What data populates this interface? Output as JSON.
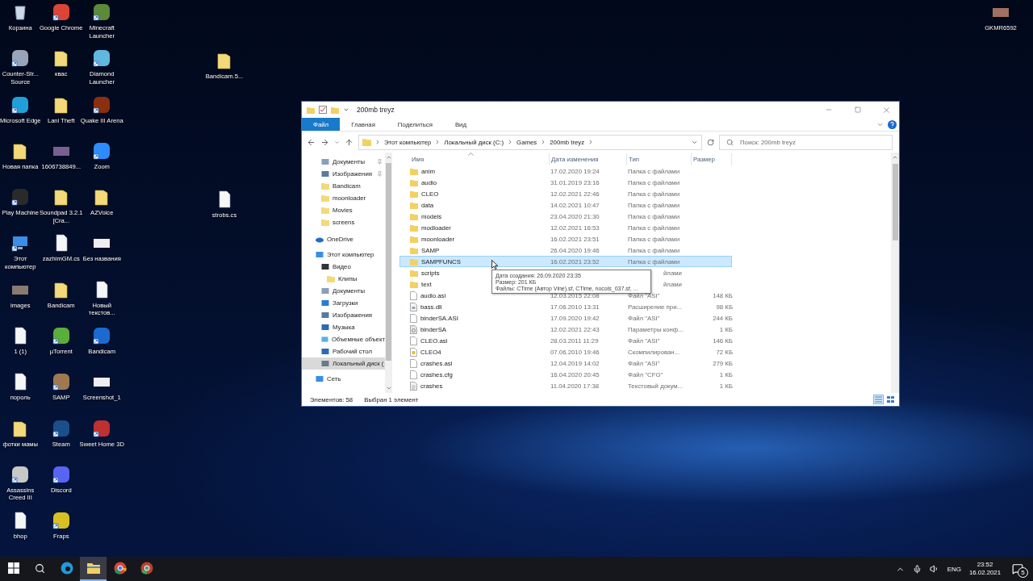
{
  "desktop_icons": [
    {
      "label": "Корзина",
      "kind": "recycle",
      "shortcut": false
    },
    {
      "label": "Counter-Str... Source",
      "kind": "app",
      "shortcut": true,
      "color": "#9aa4b8"
    },
    {
      "label": "Microsoft Edge",
      "kind": "app",
      "shortcut": true,
      "color": "#1fa0d8"
    },
    {
      "label": "Новая папка",
      "kind": "folder",
      "shortcut": false
    },
    {
      "label": "Play Machine",
      "kind": "app",
      "shortcut": true,
      "color": "#2a2a2a"
    },
    {
      "label": "Этот компьютер",
      "kind": "computer",
      "shortcut": true
    },
    {
      "label": "images",
      "kind": "image",
      "shortcut": false,
      "color": "#8a7a70"
    },
    {
      "label": "1 (1)",
      "kind": "document",
      "shortcut": false
    },
    {
      "label": "пороль",
      "kind": "document",
      "shortcut": false
    },
    {
      "label": "фотки мамы",
      "kind": "folder",
      "shortcut": false
    },
    {
      "label": "Assassins Creed III",
      "kind": "app",
      "shortcut": true,
      "color": "#c8c8c8"
    },
    {
      "label": "bhop",
      "kind": "document",
      "shortcut": false
    },
    {
      "label": "Google Chrome",
      "kind": "app",
      "shortcut": true,
      "color": "#db4437"
    },
    {
      "label": "квас",
      "kind": "folder",
      "shortcut": false
    },
    {
      "label": "Lani Theft",
      "kind": "folder",
      "shortcut": false
    },
    {
      "label": "1606738849...",
      "kind": "image",
      "shortcut": false,
      "color": "#7a6090"
    },
    {
      "label": "Soundpad 3.2.1 [Cra...",
      "kind": "folder",
      "shortcut": false
    },
    {
      "label": "zazhimGM.cs",
      "kind": "document",
      "shortcut": false
    },
    {
      "label": "Bandicam",
      "kind": "folder",
      "shortcut": false
    },
    {
      "label": "µTorrent",
      "kind": "app",
      "shortcut": true,
      "color": "#5aae3a"
    },
    {
      "label": "SAMP",
      "kind": "app",
      "shortcut": true,
      "color": "#a07850"
    },
    {
      "label": "Steam",
      "kind": "app",
      "shortcut": true,
      "color": "#1b4f8a"
    },
    {
      "label": "Discord",
      "kind": "app",
      "shortcut": true,
      "color": "#5865f2"
    },
    {
      "label": "Fraps",
      "kind": "app",
      "shortcut": true,
      "color": "#d8c020"
    },
    {
      "label": "Minecraft Launcher",
      "kind": "app",
      "shortcut": true,
      "color": "#5a8a3a"
    },
    {
      "label": "Diamond Launcher",
      "kind": "app",
      "shortcut": true,
      "color": "#60b8e0"
    },
    {
      "label": "Quake III Arena",
      "kind": "app",
      "shortcut": true,
      "color": "#8a3010"
    },
    {
      "label": "Zoom",
      "kind": "app",
      "shortcut": true,
      "color": "#2d8cff"
    },
    {
      "label": "AZVoice",
      "kind": "folder",
      "shortcut": false
    },
    {
      "label": "Без названия",
      "kind": "image",
      "shortcut": false,
      "color": "#eeeeee"
    },
    {
      "label": "Новый текстов...",
      "kind": "document",
      "shortcut": false
    },
    {
      "label": "Bandicam",
      "kind": "app",
      "shortcut": true,
      "color": "#1a6ad0"
    },
    {
      "label": "Screenshot_1",
      "kind": "image",
      "shortcut": false,
      "color": "#eeeeee"
    },
    {
      "label": "Sweet Home 3D",
      "kind": "app",
      "shortcut": true,
      "color": "#c03030"
    }
  ],
  "loose_icons": [
    {
      "label": "Bandicam.5...",
      "kind": "folder",
      "shortcut": false
    },
    {
      "label": "strobs.cs",
      "kind": "document",
      "shortcut": false
    },
    {
      "label": "GKMR6592",
      "kind": "image",
      "shortcut": false,
      "color": "#a07060"
    }
  ],
  "window": {
    "title": "200mb treyz",
    "ribbon_tabs": [
      {
        "label": "Файл",
        "kind": "file"
      },
      {
        "label": "Главная",
        "kind": "tab"
      },
      {
        "label": "Поделиться",
        "kind": "tab"
      },
      {
        "label": "Вид",
        "kind": "tab"
      }
    ],
    "breadcrumb": [
      "Этот компьютер",
      "Локальный диск (C:)",
      "Games",
      "200mb treyz"
    ],
    "search": {
      "placeholder": "Поиск: 200mb treyz"
    },
    "quick_access": [
      {
        "label": "Документы",
        "kind": "documents",
        "pinned": true,
        "selected": false
      },
      {
        "label": "Изображения",
        "kind": "pictures",
        "pinned": true,
        "selected": false
      },
      {
        "label": "Bandicam",
        "kind": "folder",
        "pinned": false,
        "selected": false
      },
      {
        "label": "moonloader",
        "kind": "folder",
        "pinned": false,
        "selected": false
      },
      {
        "label": "Movies",
        "kind": "folder",
        "pinned": false,
        "selected": false
      },
      {
        "label": "screens",
        "kind": "folder",
        "pinned": false,
        "selected": false
      }
    ],
    "tree": [
      {
        "label": "OneDrive",
        "kind": "cloud",
        "selected": false
      },
      {
        "label": "Этот компьютер",
        "kind": "computer",
        "selected": false,
        "children": [
          {
            "label": "Видео",
            "kind": "video",
            "selected": false,
            "children": [
              {
                "label": "Клипы",
                "kind": "folder",
                "selected": false
              }
            ]
          },
          {
            "label": "Документы",
            "kind": "documents",
            "selected": false
          },
          {
            "label": "Загрузки",
            "kind": "downloads",
            "selected": false
          },
          {
            "label": "Изображения",
            "kind": "pictures",
            "selected": false
          },
          {
            "label": "Музыка",
            "kind": "music",
            "selected": false
          },
          {
            "label": "Объемные объект",
            "kind": "objects",
            "selected": false
          },
          {
            "label": "Рабочий стол",
            "kind": "desktop",
            "selected": false
          },
          {
            "label": "Локальный диск (",
            "kind": "drive",
            "selected": true
          }
        ]
      },
      {
        "label": "Сеть",
        "kind": "network",
        "selected": false
      }
    ],
    "columns": [
      "Имя",
      "Дата изменения",
      "Тип",
      "Размер"
    ],
    "files": [
      {
        "name": "anim",
        "date": "17.02.2020 19:24",
        "type": "Папка с файлами",
        "kind": "folder",
        "selected": false
      },
      {
        "name": "audio",
        "date": "31.01.2019 23:16",
        "type": "Папка с файлами",
        "kind": "folder",
        "selected": false
      },
      {
        "name": "CLEO",
        "date": "12.02.2021 22:46",
        "type": "Папка с файлами",
        "kind": "folder",
        "selected": false
      },
      {
        "name": "data",
        "date": "14.02.2021 10:47",
        "type": "Папка с файлами",
        "kind": "folder",
        "selected": false
      },
      {
        "name": "models",
        "date": "23.04.2020 21:30",
        "type": "Папка с файлами",
        "kind": "folder",
        "selected": false
      },
      {
        "name": "modloader",
        "date": "12.02.2021 16:53",
        "type": "Папка с файлами",
        "kind": "folder",
        "selected": false
      },
      {
        "name": "moonloader",
        "date": "16.02.2021 23:51",
        "type": "Папка с файлами",
        "kind": "folder",
        "selected": false
      },
      {
        "name": "SAMP",
        "date": "26.04.2020 19:46",
        "type": "Папка с файлами",
        "kind": "folder",
        "selected": false
      },
      {
        "name": "SAMPFUNCS",
        "date": "16.02.2021 23:52",
        "type": "Папка с файлами",
        "kind": "folder",
        "selected": true
      },
      {
        "name": "scripts",
        "type": "йлами",
        "kind": "folder",
        "selected": false
      },
      {
        "name": "text",
        "type": "йлами",
        "kind": "folder",
        "selected": false
      },
      {
        "name": "audio.asi",
        "date": "12.03.2015 22:08",
        "type": "Файл \"ASI\"",
        "size": "148 КБ",
        "kind": "file",
        "selected": false
      },
      {
        "name": "bass.dll",
        "date": "17.06.2010 13:31",
        "type": "Расширение при...",
        "size": "98 КБ",
        "kind": "dll",
        "selected": false
      },
      {
        "name": "binderSA.ASI",
        "date": "17.09.2020 19:42",
        "type": "Файл \"ASI\"",
        "size": "244 КБ",
        "kind": "file",
        "selected": false
      },
      {
        "name": "binderSA",
        "date": "12.02.2021 22:43",
        "type": "Параметры конф...",
        "size": "1 КБ",
        "kind": "config",
        "selected": false
      },
      {
        "name": "CLEO.asi",
        "date": "28.03.2011 11:29",
        "type": "Файл \"ASI\"",
        "size": "146 КБ",
        "kind": "file",
        "selected": false
      },
      {
        "name": "CLEO4",
        "date": "07.06.2010 19:46",
        "type": "Скомпилирован...",
        "size": "72 КБ",
        "kind": "help",
        "selected": false
      },
      {
        "name": "crashes.asi",
        "date": "12.04.2019 14:02",
        "type": "Файл \"ASI\"",
        "size": "279 КБ",
        "kind": "file",
        "selected": false
      },
      {
        "name": "crashes.cfg",
        "date": "16.04.2020 20:45",
        "type": "Файл \"CFG\"",
        "size": "1 КБ",
        "kind": "file",
        "selected": false
      },
      {
        "name": "crashes",
        "date": "11.04.2020 17:38",
        "type": "Текстовый докум...",
        "size": "1 КБ",
        "kind": "text",
        "selected": false
      }
    ],
    "tooltip": [
      "Дата создания: 26.09.2020 23:35",
      "Размер: 201 КБ",
      "Файлы: CTime (Автор Vine).sf, CTime, nocols_037.sf, ..."
    ],
    "status": {
      "count": "Элементов: 58",
      "selection": "Выбран 1 элемент"
    },
    "views": [
      {
        "kind": "details",
        "selected": true
      },
      {
        "kind": "tiles",
        "selected": false
      }
    ]
  },
  "taskbar": {
    "apps": [
      {
        "kind": "edge",
        "active": false
      },
      {
        "kind": "explorer",
        "active": true
      },
      {
        "kind": "chrome",
        "active": false
      },
      {
        "kind": "chrome-alt",
        "active": false
      }
    ],
    "language": "ENG",
    "time": "23:52",
    "date": "16.02.2021",
    "notifications": "5"
  }
}
